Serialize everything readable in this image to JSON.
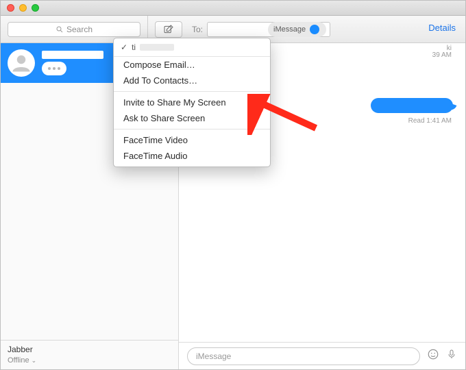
{
  "search": {
    "placeholder": "Search"
  },
  "compose_icon": "compose",
  "to_label": "To:",
  "service_pill": {
    "label": "iMessage"
  },
  "details_link": "Details",
  "dropdown": {
    "checked_prefix": "ti",
    "items": [
      "Compose Email…",
      "Add To Contacts…"
    ],
    "items2": [
      "Invite to Share My Screen",
      "Ask to Share Screen"
    ],
    "items3": [
      "FaceTime Video",
      "FaceTime Audio"
    ]
  },
  "conversation": {
    "meta_suffix_1": "ki",
    "meta_suffix_2": "39 AM",
    "read_line": "Read 1:41 AM"
  },
  "sidebar_status": {
    "account": "Jabber",
    "state": "Offline"
  },
  "input_placeholder": "iMessage"
}
